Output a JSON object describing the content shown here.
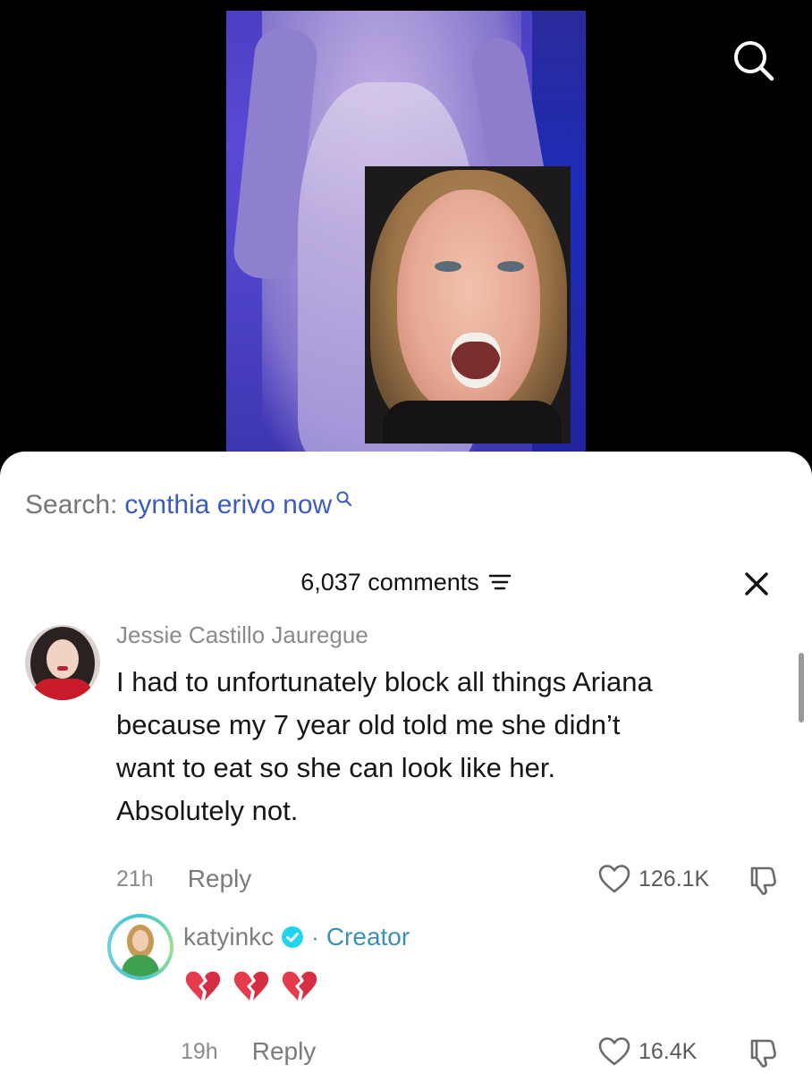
{
  "search": {
    "prefix": "Search:",
    "query": "cynthia erivo now"
  },
  "comments_header": {
    "count_label": "6,037 comments"
  },
  "comment": {
    "username": "Jessie Castillo Jauregue",
    "text_lines": [
      "I had to unfortunately block all things Ariana",
      "because my 7 year old told me she didn’t",
      "want to eat so she can look like her.",
      "Absolutely not."
    ],
    "time": "21h",
    "reply_label": "Reply",
    "likes": "126.1K"
  },
  "reply": {
    "username": "katyinkc",
    "separator": "·",
    "creator_label": "Creator",
    "emoji": [
      "💔",
      "💔",
      "💔"
    ],
    "time": "19h",
    "reply_label": "Reply",
    "likes": "16.4K"
  },
  "colors": {
    "link_blue": "#3c5cbc",
    "creator_blue": "#3d8fb6",
    "verified_blue": "#20d5ec",
    "broken_heart": "#e53b4d"
  },
  "icons": {
    "video_search": "search-icon",
    "inline_search": "search-icon",
    "sort": "filter-lines-icon",
    "close": "close-icon",
    "like": "heart-outline-icon",
    "dislike": "thumbs-down-outline-icon",
    "verified": "verified-check-icon"
  }
}
